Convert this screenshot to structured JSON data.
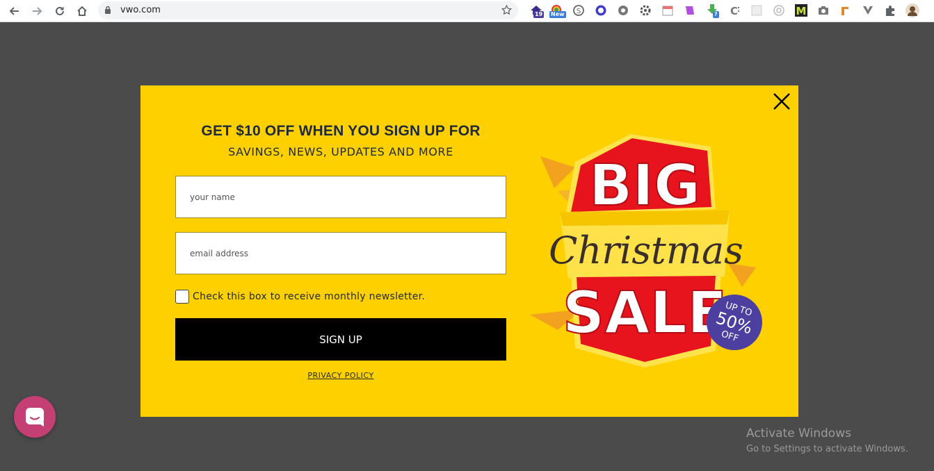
{
  "browser": {
    "url": "vwo.com",
    "nav": {
      "back_icon": "arrow-left-icon",
      "forward_icon": "arrow-right-icon",
      "reload_icon": "reload-icon",
      "home_icon": "home-icon"
    },
    "extensions": [
      {
        "icon": "extension-house-icon",
        "badge": "19",
        "badge_color": "#4b3f9e"
      },
      {
        "icon": "extension-rainbow-icon",
        "badge": "New",
        "badge_color": "#3b7ddd"
      },
      {
        "icon": "extension-skype-icon"
      },
      {
        "icon": "extension-circle-icon"
      },
      {
        "icon": "extension-gear-icon"
      },
      {
        "icon": "extension-cog-icon"
      },
      {
        "icon": "extension-calendar-icon"
      },
      {
        "icon": "extension-purple-icon"
      },
      {
        "icon": "extension-download-icon",
        "badge": "?",
        "badge_color": "#3b7ddd"
      },
      {
        "icon": "extension-c-icon"
      },
      {
        "icon": "extension-grid-icon"
      },
      {
        "icon": "extension-target-icon"
      },
      {
        "icon": "extension-m-icon",
        "label": "M"
      },
      {
        "icon": "extension-camera-icon"
      },
      {
        "icon": "extension-tool-icon"
      },
      {
        "icon": "extension-v-icon"
      },
      {
        "icon": "extensions-puzzle-icon"
      },
      {
        "icon": "profile-avatar-icon"
      }
    ]
  },
  "popup": {
    "headline": "GET $10 OFF WHEN YOU SIGN UP FOR",
    "subline": "SAVINGS, NEWS, UPDATES AND MORE",
    "name_placeholder": "your name",
    "email_placeholder": "email address",
    "checkbox_label": "Check this box to receive monthly newsletter.",
    "submit_label": "SIGN UP",
    "privacy_label": "PRIVACY POLICY",
    "close_icon": "close-icon",
    "promo": {
      "line1": "BIG",
      "line2": "Christmas",
      "line3": "SALE",
      "badge_line1": "UP TO",
      "badge_line2": "50%",
      "badge_line3": "OFF"
    }
  },
  "chat": {
    "icon": "chat-bubble-icon"
  },
  "watermark": {
    "title": "Activate Windows",
    "subtitle": "Go to Settings to activate Windows."
  },
  "colors": {
    "popup_bg": "#fed000",
    "overlay": "#4b4b4b",
    "button": "#000000",
    "text": "#1e2a38",
    "sale_red": "#e8141d",
    "badge_purple": "#4d3fa0",
    "chat": "#c33f74"
  }
}
